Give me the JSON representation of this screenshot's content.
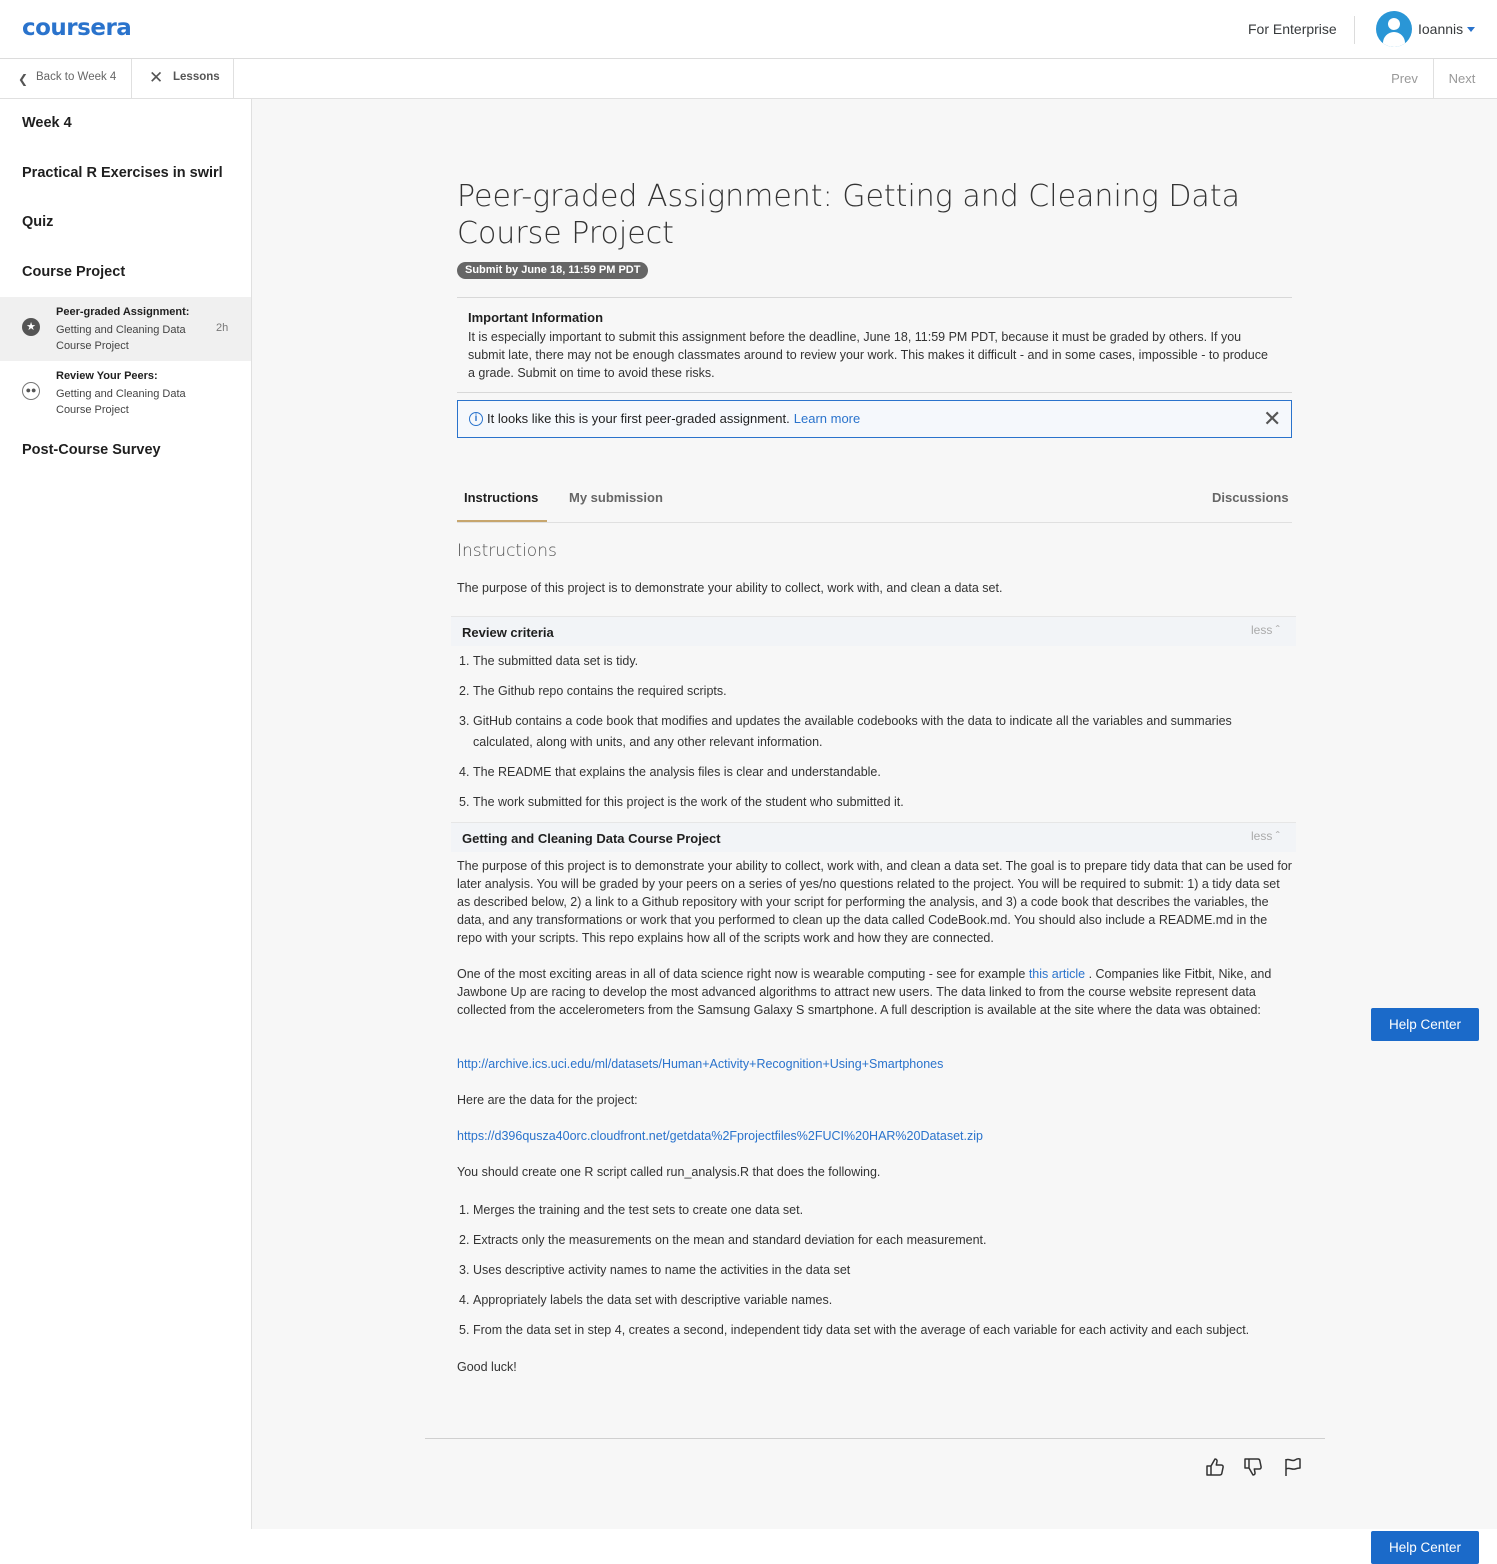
{
  "header": {
    "logo": "coursera",
    "enterprise_link": "For Enterprise",
    "user_name": "Ioannis"
  },
  "subnav": {
    "back_label": "Back to Week 4",
    "lessons_label": "Lessons",
    "prev_label": "Prev",
    "next_label": "Next"
  },
  "sidebar": {
    "week_title": "Week 4",
    "section_practical": "Practical R Exercises in swirl",
    "section_quiz": "Quiz",
    "section_project": "Course Project",
    "items": [
      {
        "title": "Peer-graded Assignment:",
        "subtitle": "Getting and Cleaning Data Course Project",
        "duration": "2h"
      },
      {
        "title": "Review Your Peers:",
        "subtitle": "Getting and Cleaning Data Course Project"
      }
    ],
    "section_survey": "Post-Course Survey"
  },
  "main": {
    "title": "Peer-graded Assignment: Getting and Cleaning Data Course Project",
    "deadline_badge": "Submit by June 18, 11:59 PM PDT",
    "important_title": "Important Information",
    "important_text": "It is especially important to submit this assignment before the deadline, June 18, 11:59 PM PDT, because it must be graded by others. If you submit late, there may not be enough classmates around to review your work. This makes it difficult - and in some cases, impossible - to produce a grade. Submit on time to avoid these risks.",
    "notice_text": "It looks like this is your first peer-graded assignment.",
    "notice_link": "Learn more",
    "tabs": {
      "instructions": "Instructions",
      "my_submission": "My submission",
      "discussions": "Discussions"
    },
    "section_heading": "Instructions",
    "intro": "The purpose of this project is to demonstrate your ability to collect, work with, and clean a data set.",
    "review_criteria_title": "Review criteria",
    "less_label": "less",
    "review_criteria": [
      "The submitted data set is tidy.",
      "The Github repo contains the required scripts.",
      "GitHub contains a code book that modifies and updates the available codebooks with the data to indicate all the variables and summaries calculated, along with units, and any other relevant information.",
      "The README that explains the analysis files is clear and understandable.",
      "The work submitted for this project is the work of the student who submitted it."
    ],
    "project_title": "Getting and Cleaning Data Course Project",
    "project_para1": "The purpose of this project is to demonstrate your ability to collect, work with, and clean a data set. The goal is to prepare tidy data that can be used for later analysis. You will be graded by your peers on a series of yes/no questions related to the project. You will be required to submit: 1) a tidy data set as described below, 2) a link to a Github repository with your script for performing the analysis, and 3) a code book that describes the variables, the data, and any transformations or work that you performed to clean up the data called CodeBook.md. You should also include a README.md in the repo with your scripts. This repo explains how all of the scripts work and how they are connected.",
    "project_para2_before": "One of the most exciting areas in all of data science right now is wearable computing - see for example ",
    "project_para2_link": "this article",
    "project_para2_after": " . Companies like Fitbit, Nike, and Jawbone Up are racing to develop the most advanced algorithms to attract new users. The data linked to from the course website represent data collected from the accelerometers from the Samsung Galaxy S smartphone. A full description is available at the site where the data was obtained:",
    "dataset_url": "http://archive.ics.uci.edu/ml/datasets/Human+Activity+Recognition+Using+Smartphones",
    "data_label": "Here are the data for the project:",
    "data_url": "https://d396qusza40orc.cloudfront.net/getdata%2Fprojectfiles%2FUCI%20HAR%20Dataset.zip",
    "script_intro": "You should create one R script called run_analysis.R that does the following.",
    "steps": [
      "Merges the training and the test sets to create one data set.",
      "Extracts only the measurements on the mean and standard deviation for each measurement.",
      "Uses descriptive activity names to name the activities in the data set",
      "Appropriately labels the data set with descriptive variable names.",
      "From the data set in step 4, creates a second, independent tidy data set with the average of each variable for each activity and each subject."
    ],
    "closing": "Good luck!"
  },
  "help_center_label": "Help Center",
  "icons": {
    "like": "thumbs-up-icon",
    "dislike": "thumbs-down-icon",
    "flag": "flag-icon"
  },
  "colors": {
    "brand": "#2a73cc",
    "help_button": "#1b6ac9",
    "tab_underline": "#c7a66e"
  }
}
